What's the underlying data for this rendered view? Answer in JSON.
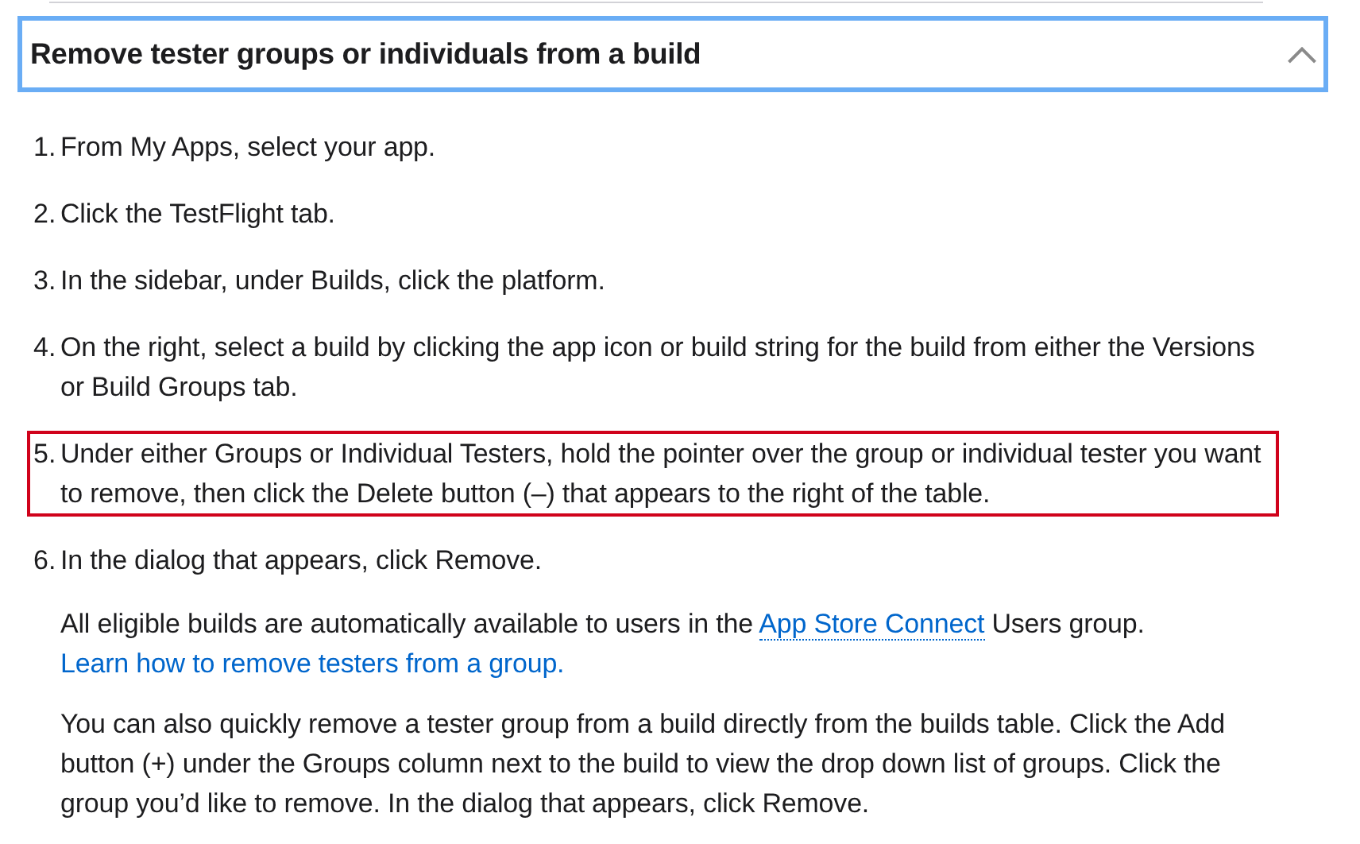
{
  "section": {
    "title": "Remove tester groups or individuals from a build",
    "expanded": true
  },
  "steps": [
    {
      "number": "1.",
      "text": "From My Apps, select your app.",
      "highlighted": false
    },
    {
      "number": "2.",
      "text": "Click the TestFlight tab.",
      "highlighted": false
    },
    {
      "number": "3.",
      "text": "In the sidebar, under Builds, click the platform.",
      "highlighted": false
    },
    {
      "number": "4.",
      "text": "On the right, select a build by clicking the app icon or build string for the build from either the Versions or Build Groups tab.",
      "highlighted": false
    },
    {
      "number": "5.",
      "text": "Under either Groups or Individual Testers, hold the pointer over the group or individual tester you want to remove, then click the Delete button (–) that appears to the right of the table.",
      "highlighted": true
    },
    {
      "number": "6.",
      "text": "In the dialog that appears, click Remove.",
      "highlighted": false
    }
  ],
  "notes": [
    {
      "segments": [
        {
          "kind": "text",
          "text": "All eligible builds are automatically available to users in the "
        },
        {
          "kind": "term",
          "text": "App Store Connect"
        },
        {
          "kind": "text",
          "text": " Users group. "
        },
        {
          "kind": "link",
          "text": "Learn how to remove testers from a group."
        }
      ]
    },
    {
      "segments": [
        {
          "kind": "text",
          "text": "You can also quickly remove a tester group from a build directly from the builds table. Click the Add button (+) under the Groups column next to the build to view the drop down list of groups. Click the group you’d like to remove. In the dialog that appears, click Remove."
        }
      ]
    }
  ]
}
